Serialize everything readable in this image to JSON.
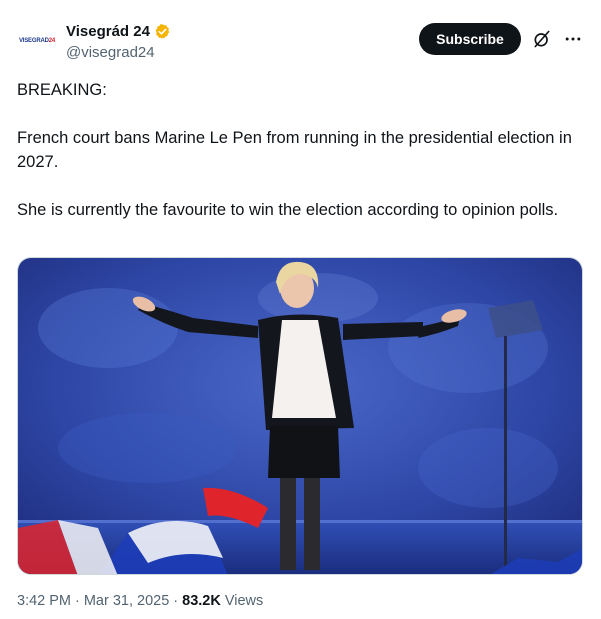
{
  "author": {
    "avatar_text_main": "VISEGRAD",
    "avatar_text_accent": "24",
    "display_name": "Visegrád 24",
    "handle": "@visegrad24",
    "verified_color": "#f4b400"
  },
  "actions": {
    "subscribe_label": "Subscribe",
    "grok_icon": "grok-icon",
    "more_icon": "more-horizontal-icon"
  },
  "tweet": {
    "paragraphs": [
      "BREAKING:",
      "French court bans Marine Le Pen from running in the presidential election in 2027.",
      "She is currently the favourite to win the election according to opinion polls."
    ]
  },
  "media": {
    "description": "photo"
  },
  "meta": {
    "time": "3:42 PM",
    "date": "Mar 31, 2025",
    "views_count": "83.2K",
    "views_label": "Views",
    "separator": "·"
  },
  "colors": {
    "text": "#0f1419",
    "secondary": "#536471",
    "subscribe_bg": "#0f1419",
    "stage_blue": "#2a3f9e"
  }
}
